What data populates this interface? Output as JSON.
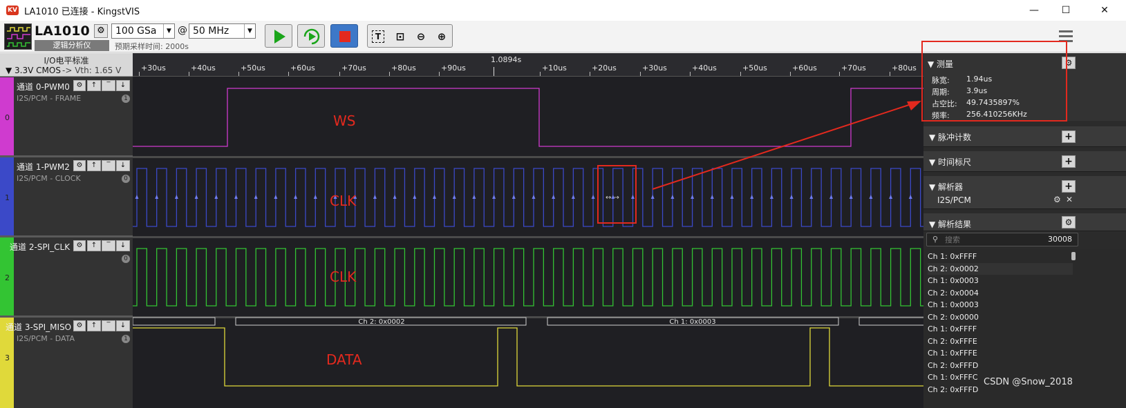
{
  "window": {
    "title": "LA1010 已连接 - KingstVIS",
    "logo": "KV",
    "minimize": "—",
    "maximize": "☐",
    "close": "✕"
  },
  "toolbar": {
    "device_name": "LA1010",
    "device_subtitle": "逻辑分析仪",
    "sample_depth": "100 GSa",
    "sample_rate": "50 MHz",
    "at_sign": "@",
    "estimated_time": "预期采样时间: 2000s",
    "tool_icons": [
      "text-tool-icon",
      "zoom-fit-icon",
      "zoom-out-icon",
      "zoom-in-icon"
    ]
  },
  "io": {
    "header": "I/O电平标准",
    "standard": "▼ 3.3V CMOS",
    "vth": "-> Vth: 1.65 V"
  },
  "channels": [
    {
      "index": "0",
      "name": "通道 0-PWM0",
      "decoder": "I2S/PCM - FRAME",
      "count": "1",
      "color": "#cf3bcf"
    },
    {
      "index": "1",
      "name": "通道 1-PWM2",
      "decoder": "I2S/PCM - CLOCK",
      "count": "0",
      "color": "#3b49c8"
    },
    {
      "index": "2",
      "name": "通道 2-SPI_CLK",
      "decoder": "",
      "count": "0",
      "color": "#33c433"
    },
    {
      "index": "3",
      "name": "通道 3-SPI_MISO",
      "decoder": "I2S/PCM - DATA",
      "count": "1",
      "color": "#e0d93a"
    }
  ],
  "ruler": {
    "center": "1.0894s",
    "ticks": [
      "+30us",
      "+40us",
      "+50us",
      "+60us",
      "+70us",
      "+80us",
      "+90us",
      "+10us",
      "+20us",
      "+30us",
      "+40us",
      "+50us",
      "+60us",
      "+70us",
      "+80us"
    ]
  },
  "annotations": {
    "ws": "WS",
    "clk1": "CLK",
    "clk2": "CLK",
    "data": "DATA"
  },
  "data_labels": [
    "Ch 2: 0x0002",
    "Ch 1: 0x0003"
  ],
  "measure": {
    "title": "▼ 测量",
    "rows": [
      {
        "label": "脉宽:",
        "value": "1.94us"
      },
      {
        "label": "周期:",
        "value": "3.9us"
      },
      {
        "label": "占空比:",
        "value": "49.7435897%"
      },
      {
        "label": "频率:",
        "value": "256.410256KHz"
      }
    ]
  },
  "sections": {
    "pulse_count": "▼ 脉冲计数",
    "time_ruler": "▼ 时间标尺",
    "analyzers": "▼ 解析器",
    "analyzer_item": "I2S/PCM",
    "results": "▼ 解析结果",
    "plus": "+",
    "gear": "⚙",
    "remove": "✕"
  },
  "search": {
    "placeholder": "搜索",
    "count": "30008"
  },
  "results": [
    "Ch 1: 0xFFFF",
    "Ch 2: 0x0002",
    "Ch 1: 0x0003",
    "Ch 2: 0x0004",
    "Ch 1: 0x0003",
    "Ch 2: 0x0000",
    "Ch 1: 0xFFFF",
    "Ch 2: 0xFFFE",
    "Ch 1: 0xFFFE",
    "Ch 2: 0xFFFD",
    "Ch 1: 0xFFFC",
    "Ch 2: 0xFFFD"
  ],
  "watermark": "CSDN @Snow_2018"
}
